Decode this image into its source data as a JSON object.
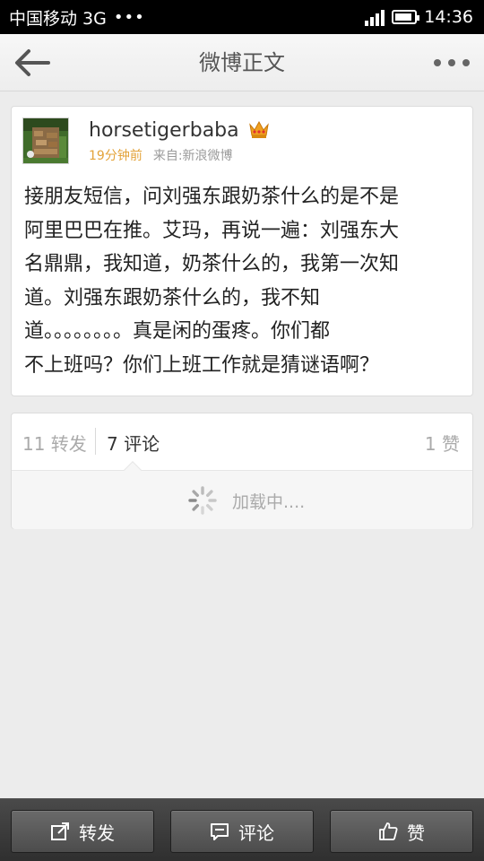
{
  "status_bar": {
    "carrier": "中国移动 3G",
    "dots": "•••",
    "time": "14:36"
  },
  "header": {
    "title": "微博正文"
  },
  "post": {
    "username": "horsetigerbaba",
    "time_ago": "19分钟前",
    "source": "来自:新浪微博",
    "text_lines": [
      "接朋友短信，问刘强东跟奶茶什么的是不是",
      "阿里巴巴在推。艾玛，再说一遍：刘强东大",
      "名鼎鼎，我知道，奶茶什么的，我第一次知",
      "道。刘强东跟奶茶什么的，我不知",
      "道。。。。。。。。真是闲的蛋疼。你们都",
      "不上班吗？你们上班工作就是猜谜语啊？"
    ]
  },
  "stats": {
    "repost": "11 转发",
    "comment": "7 评论",
    "like": "1 赞",
    "loading": "加载中...."
  },
  "toolbar": {
    "repost_label": "转发",
    "comment_label": "评论",
    "like_label": "赞"
  },
  "colors": {
    "time_accent": "#e3a33a",
    "crown": "#f0a020"
  }
}
